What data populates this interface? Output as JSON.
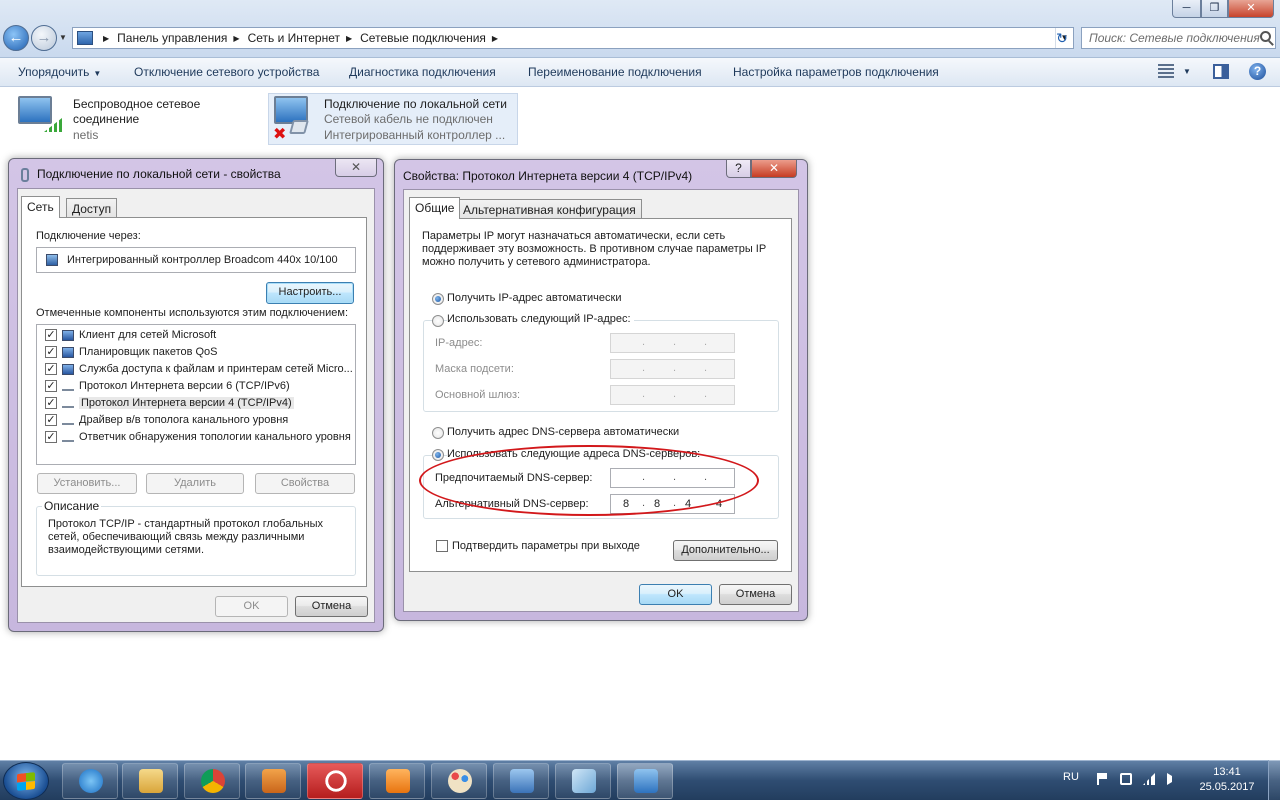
{
  "address": {
    "crumbs": [
      "Панель управления",
      "Сеть и Интернет",
      "Сетевые подключения"
    ],
    "search_placeholder": "Поиск: Сетевые подключения"
  },
  "toolbar": {
    "organize": "Упорядочить",
    "disable": "Отключение сетевого устройства",
    "diagnose": "Диагностика подключения",
    "rename": "Переименование подключения",
    "settings": "Настройка параметров подключения"
  },
  "adapters": [
    {
      "name": "Беспроводное сетевое соединение",
      "sub1": "netis",
      "icon": "wifi-adapter-icon"
    },
    {
      "name": "Подключение по локальной сети",
      "sub1": "Сетевой кабель не подключен",
      "sub2": "Интегрированный контроллер ...",
      "icon": "lan-adapter-icon"
    }
  ],
  "lan_dialog": {
    "title": "Подключение по локальной сети - свойства",
    "tabs": [
      "Сеть",
      "Доступ"
    ],
    "connect_using_label": "Подключение через:",
    "adapter_name": "Интегрированный контроллер Broadcom 440x 10/100",
    "configure_btn": "Настроить...",
    "components_label": "Отмеченные компоненты используются этим подключением:",
    "components": [
      {
        "label": "Клиент для сетей Microsoft",
        "checked": true
      },
      {
        "label": "Планировщик пакетов QoS",
        "checked": true
      },
      {
        "label": "Служба доступа к файлам и принтерам сетей Micro...",
        "checked": true
      },
      {
        "label": "Протокол Интернета версии 6 (TCP/IPv6)",
        "checked": true
      },
      {
        "label": "Протокол Интернета версии 4 (TCP/IPv4)",
        "checked": true
      },
      {
        "label": "Драйвер в/в тополога канального уровня",
        "checked": true
      },
      {
        "label": "Ответчик обнаружения топологии канального уровня",
        "checked": true
      }
    ],
    "install_btn": "Установить...",
    "remove_btn": "Удалить",
    "properties_btn": "Свойства",
    "description_label": "Описание",
    "description": "Протокол TCP/IP - стандартный протокол глобальных сетей, обеспечивающий связь между различными взаимодействующими сетями.",
    "ok_btn": "OK",
    "cancel_btn": "Отмена"
  },
  "ipv4_dialog": {
    "title": "Свойства: Протокол Интернета версии 4 (TCP/IPv4)",
    "help_glyph": "?",
    "tabs": [
      "Общие",
      "Альтернативная конфигурация"
    ],
    "intro": "Параметры IP могут назначаться автоматически, если сеть поддерживает эту возможность. В противном случае параметры IP можно получить у сетевого администратора.",
    "auto_ip": "Получить IP-адрес автоматически",
    "manual_ip": "Использовать следующий IP-адрес:",
    "ip_label": "IP-адрес:",
    "mask_label": "Маска подсети:",
    "gateway_label": "Основной шлюз:",
    "auto_dns": "Получить адрес DNS-сервера автоматически",
    "manual_dns": "Использовать следующие адреса DNS-серверов:",
    "preferred_dns_label": "Предпочитаемый DNS-сервер:",
    "preferred_dns": [
      "",
      "",
      "",
      ""
    ],
    "alternate_dns_label": "Альтернативный DNS-сервер:",
    "alternate_dns": [
      "8",
      "8",
      "4",
      "4"
    ],
    "validate_label": "Подтвердить параметры при выходе",
    "advanced_btn": "Дополнительно...",
    "ok_btn": "OK",
    "cancel_btn": "Отмена",
    "ip_mode": "auto",
    "dns_mode": "manual",
    "validate_checked": false
  },
  "taskbar": {
    "apps": [
      "internet-explorer-icon",
      "file-explorer-icon",
      "chrome-icon",
      "media-player-icon",
      "opera-icon",
      "uc-browser-icon",
      "paint-icon",
      "network-monitor-icon",
      "notepad-icon",
      "control-panel-icon"
    ],
    "lang": "RU",
    "time": "13:41",
    "date": "25.05.2017"
  },
  "colors": {
    "annotation": "#d2181b",
    "dialog_frame": "#c7b7de",
    "taskbar": "#2f4d72"
  }
}
